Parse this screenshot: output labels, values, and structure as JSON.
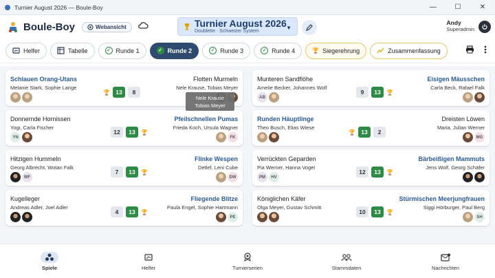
{
  "window": {
    "title": "Turnier August 2026 — Boule-Boy"
  },
  "header": {
    "brand": "Boule-Boy",
    "webansicht": "Webansicht",
    "tournament_title": "Turnier August 2026",
    "tournament_subtitle": "Doublette · Schweizer System",
    "user_name": "Andy",
    "user_role": "Superadmin"
  },
  "toolbar": {
    "helfer": "Helfer",
    "tabelle": "Tabelle",
    "runde1": "Runde 1",
    "runde2": "Runde 2",
    "runde3": "Runde 3",
    "runde4": "Runde 4",
    "siegerehrung": "Siegerehrung",
    "zusammenfassung": "Zusammenfassung"
  },
  "matches": [
    {
      "left": {
        "name": "Schlauen Orang-Utans",
        "players": "Melanie Stark, Sophie Lange",
        "score": 13,
        "win": true
      },
      "right": {
        "name": "Flotten Murmeln",
        "players": "Nele Krause, Tobias Meyer",
        "score": 8,
        "win": false
      }
    },
    {
      "left": {
        "name": "Munteren Sandflöhe",
        "players": "Amelie Becker, Johannes Wolf",
        "score": 9,
        "win": false,
        "ini": "AB"
      },
      "right": {
        "name": "Eisigen Mäusschen",
        "players": "Carla Beck, Rafael Falk",
        "score": 13,
        "win": true
      }
    },
    {
      "left": {
        "name": "Donnernde Hornissen",
        "players": "Yogi, Carla Fischer",
        "score": 12,
        "win": false,
        "ini": "YN"
      },
      "right": {
        "name": "Pfeilschnellen Pumas",
        "players": "Frieda Koch, Ursula Wagner",
        "score": 13,
        "win": true,
        "ini": "FK"
      }
    },
    {
      "left": {
        "name": "Runden Häuptlinge",
        "players": "Theo Busch, Elias Wiese",
        "score": 13,
        "win": true
      },
      "right": {
        "name": "Dreisten Löwen",
        "players": "Maria, Julian Werner",
        "score": 2,
        "win": false,
        "ini": "MG"
      }
    },
    {
      "left": {
        "name": "Hitzigen Hummeln",
        "players": "Georg Albrecht, Wotan Falk",
        "score": 7,
        "win": false,
        "ini": "WF"
      },
      "right": {
        "name": "Flinke Wespen",
        "players": "Detlef, Leni Cube",
        "score": 13,
        "win": true,
        "ini": "DW"
      }
    },
    {
      "left": {
        "name": "Verrückten Geparden",
        "players": "Pia Werner, Hanna Vogel",
        "score": 12,
        "win": false,
        "ini": "PM",
        "ini2": "HV"
      },
      "right": {
        "name": "Bärbeißigen Mammuts",
        "players": "Jens Wolf, Georg Schäfer",
        "score": 13,
        "win": true
      }
    },
    {
      "left": {
        "name": "Kugelleger",
        "players": "Andreas Adler, Joel Adler",
        "score": 4,
        "win": false
      },
      "right": {
        "name": "Fliegende Blitze",
        "players": "Paula Engel, Sophie Hartmann",
        "score": 13,
        "win": true,
        "ini": "PE"
      }
    },
    {
      "left": {
        "name": "Königlichen Käfer",
        "players": "Olga Meyer, Gustav Schmitt",
        "score": 10,
        "win": false
      },
      "right": {
        "name": "Stürmischen Meerjungfrauen",
        "players": "Siggi Hörburger, Paul Berg",
        "score": 13,
        "win": true,
        "ini": "SH"
      }
    }
  ],
  "tooltip": {
    "line1": "Nele Krause",
    "line2": "Tobias Meyer"
  },
  "nav": {
    "spiele": "Spiele",
    "helfer": "Helfer",
    "turnierserien": "Turnierserien",
    "stammdaten": "Stammdaten",
    "nachrichten": "Nachrichten"
  },
  "colors": {
    "accent": "#2e4a6e",
    "win": "#2e8b46",
    "winner_text": "#2b5a9a",
    "trophy": "#e0a700"
  }
}
